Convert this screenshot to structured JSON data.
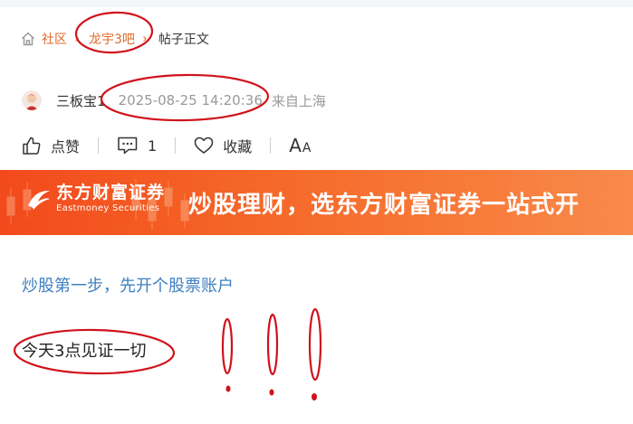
{
  "breadcrumb": {
    "community": "社区",
    "bar": "龙宇3吧",
    "current": "帖子正文"
  },
  "author": {
    "name": "三板宝1",
    "time": "2025-08-25 14:20:36",
    "location": "来自上海"
  },
  "actions": {
    "like_label": "点赞",
    "comment_count": "1",
    "collect_label": "收藏",
    "font_big": "A",
    "font_small": "A"
  },
  "banner": {
    "brand_cn": "东方财富证券",
    "brand_en": "Eastmoney Securities",
    "slogan": "炒股理财，选东方财富证券一站式开"
  },
  "promo_link": "炒股第一步，先开个股票账户",
  "post_body": "今天3点见证一切",
  "colors": {
    "accent": "#e0692a",
    "link": "#3d7fc1",
    "annotation": "#d0121b",
    "banner_start": "#f24a1c",
    "banner_end": "#f98a4a"
  }
}
